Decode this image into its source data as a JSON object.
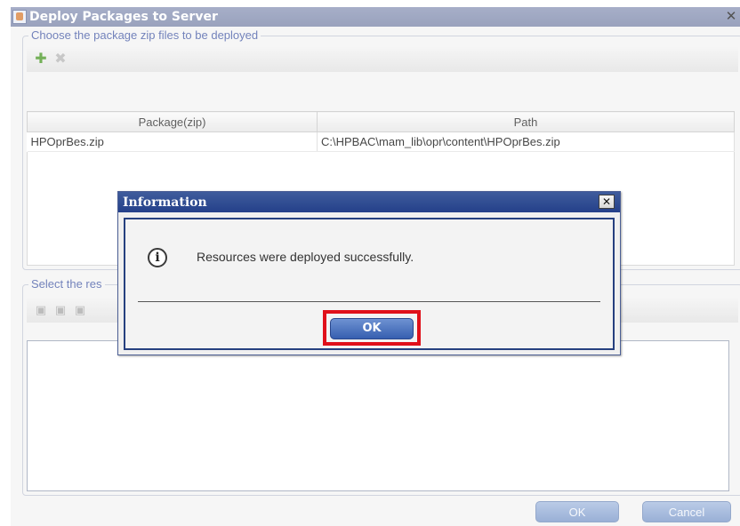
{
  "main_window": {
    "title": "Deploy Packages to Server",
    "close_label": "✕"
  },
  "packages_group": {
    "legend": "Choose the package zip files to be deployed",
    "columns": [
      "Package(zip)",
      "Path"
    ],
    "rows": [
      {
        "package": "HPOprBes.zip",
        "path": "C:\\HPBAC\\mam_lib\\opr\\content\\HPOprBes.zip"
      }
    ]
  },
  "resources_group": {
    "legend": "Select the res"
  },
  "footer": {
    "ok_label": "OK",
    "cancel_label": "Cancel"
  },
  "dialog": {
    "title": "Information",
    "close_label": "✕",
    "icon": "info-icon",
    "message": "Resources were deployed successfully.",
    "ok_label": "OK"
  },
  "colors": {
    "highlight": "#e0101a",
    "dialog_titlebar": "#24408a",
    "legend_text": "#4b5fa8"
  }
}
